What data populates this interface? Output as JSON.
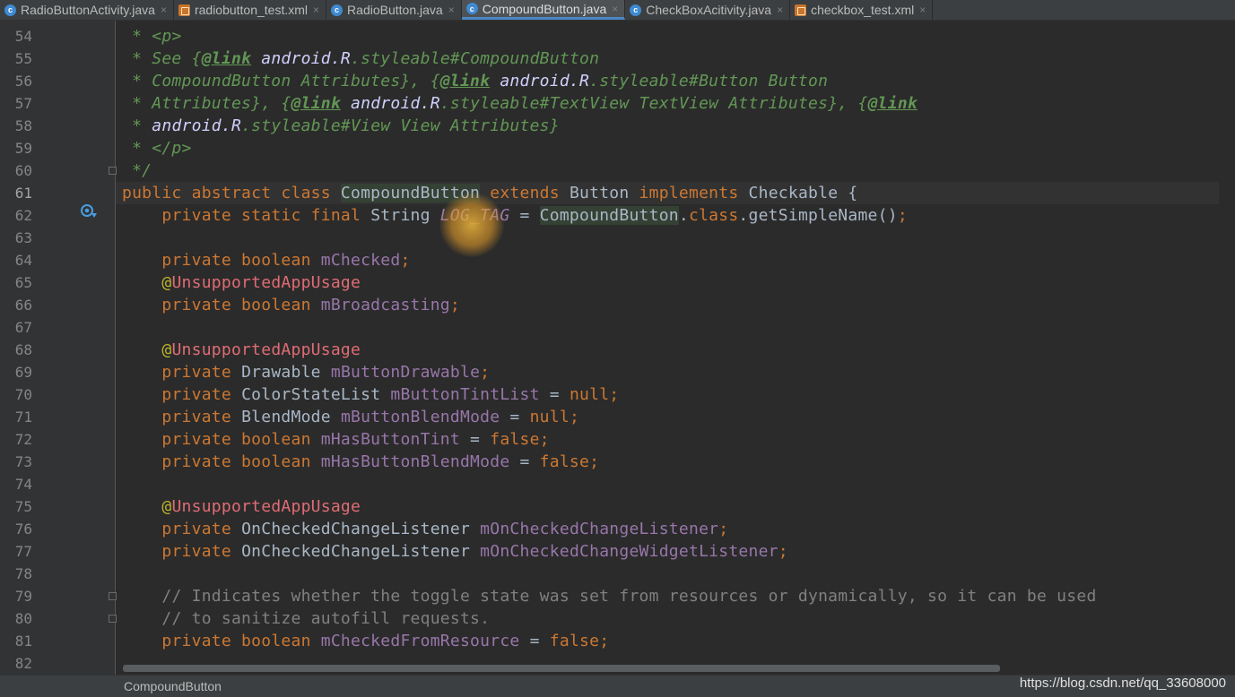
{
  "tabs": [
    {
      "name": "RadioButtonActivity.java",
      "type": "java",
      "active": false
    },
    {
      "name": "radiobutton_test.xml",
      "type": "xml",
      "active": false
    },
    {
      "name": "RadioButton.java",
      "type": "java",
      "active": false
    },
    {
      "name": "CompoundButton.java",
      "type": "java",
      "active": true
    },
    {
      "name": "CheckBoxAcitivity.java",
      "type": "java",
      "active": false
    },
    {
      "name": "checkbox_test.xml",
      "type": "xml",
      "active": false
    }
  ],
  "tab_close_glyph": "×",
  "editor": {
    "current_line": 61,
    "lines": [
      {
        "n": 54,
        "tokens": [
          [
            "doc",
            " * "
          ],
          [
            "doc",
            "<p>"
          ]
        ]
      },
      {
        "n": 55,
        "tokens": [
          [
            "doc",
            " * See {"
          ],
          [
            "doctag",
            "@link"
          ],
          [
            "doc",
            " "
          ],
          [
            "docb",
            "android.R"
          ],
          [
            "doc",
            ".styleable#CompoundButton"
          ]
        ]
      },
      {
        "n": 56,
        "tokens": [
          [
            "doc",
            " * CompoundButton Attributes}, {"
          ],
          [
            "doctag",
            "@link"
          ],
          [
            "doc",
            " "
          ],
          [
            "docb",
            "android.R"
          ],
          [
            "doc",
            ".styleable#Button Button"
          ]
        ]
      },
      {
        "n": 57,
        "tokens": [
          [
            "doc",
            " * Attributes}, {"
          ],
          [
            "doctag",
            "@link"
          ],
          [
            "doc",
            " "
          ],
          [
            "docb",
            "android.R"
          ],
          [
            "doc",
            ".styleable#TextView TextView Attributes}, {"
          ],
          [
            "doctag",
            "@link"
          ]
        ]
      },
      {
        "n": 58,
        "tokens": [
          [
            "doc",
            " * "
          ],
          [
            "docb",
            "android.R"
          ],
          [
            "doc",
            ".styleable#View View Attributes}"
          ]
        ]
      },
      {
        "n": 59,
        "tokens": [
          [
            "doc",
            " * </p>"
          ]
        ]
      },
      {
        "n": 60,
        "tokens": [
          [
            "doc",
            " */"
          ]
        ]
      },
      {
        "n": 61,
        "tokens": [
          [
            "kw",
            "public abstract class "
          ],
          [
            "hl",
            "CompoundButton"
          ],
          [
            "pl",
            " "
          ],
          [
            "kw",
            "extends "
          ],
          [
            "pl",
            "Button "
          ],
          [
            "kw",
            "implements "
          ],
          [
            "pl",
            "Checkable {"
          ]
        ]
      },
      {
        "n": 62,
        "tokens": [
          [
            "pl",
            "    "
          ],
          [
            "kw",
            "private static final "
          ],
          [
            "pl",
            "String "
          ],
          [
            "sfield",
            "LOG_TAG"
          ],
          [
            "pl",
            " = "
          ],
          [
            "hl",
            "CompoundButton"
          ],
          [
            "pl",
            "."
          ],
          [
            "kw",
            "class"
          ],
          [
            "pl",
            ".getSimpleName()"
          ],
          [
            "kw",
            ";"
          ]
        ]
      },
      {
        "n": 63,
        "tokens": []
      },
      {
        "n": 64,
        "tokens": [
          [
            "pl",
            "    "
          ],
          [
            "kw",
            "private boolean "
          ],
          [
            "field",
            "mChecked"
          ],
          [
            "kw",
            ";"
          ]
        ]
      },
      {
        "n": 65,
        "tokens": [
          [
            "pl",
            "    "
          ],
          [
            "anno",
            "@"
          ],
          [
            "annoerr",
            "UnsupportedAppUsage"
          ]
        ]
      },
      {
        "n": 66,
        "tokens": [
          [
            "pl",
            "    "
          ],
          [
            "kw",
            "private boolean "
          ],
          [
            "field",
            "mBroadcasting"
          ],
          [
            "kw",
            ";"
          ]
        ]
      },
      {
        "n": 67,
        "tokens": []
      },
      {
        "n": 68,
        "tokens": [
          [
            "pl",
            "    "
          ],
          [
            "anno",
            "@"
          ],
          [
            "annoerr",
            "UnsupportedAppUsage"
          ]
        ]
      },
      {
        "n": 69,
        "tokens": [
          [
            "pl",
            "    "
          ],
          [
            "kw",
            "private "
          ],
          [
            "pl",
            "Drawable "
          ],
          [
            "field",
            "mButtonDrawable"
          ],
          [
            "kw",
            ";"
          ]
        ]
      },
      {
        "n": 70,
        "tokens": [
          [
            "pl",
            "    "
          ],
          [
            "kw",
            "private "
          ],
          [
            "pl",
            "ColorStateList "
          ],
          [
            "field",
            "mButtonTintList"
          ],
          [
            "pl",
            " = "
          ],
          [
            "kw",
            "null;"
          ]
        ]
      },
      {
        "n": 71,
        "tokens": [
          [
            "pl",
            "    "
          ],
          [
            "kw",
            "private "
          ],
          [
            "pl",
            "BlendMode "
          ],
          [
            "field",
            "mButtonBlendMode"
          ],
          [
            "pl",
            " = "
          ],
          [
            "kw",
            "null;"
          ]
        ]
      },
      {
        "n": 72,
        "tokens": [
          [
            "pl",
            "    "
          ],
          [
            "kw",
            "private boolean "
          ],
          [
            "field",
            "mHasButtonTint"
          ],
          [
            "pl",
            " = "
          ],
          [
            "kw",
            "false;"
          ]
        ]
      },
      {
        "n": 73,
        "tokens": [
          [
            "pl",
            "    "
          ],
          [
            "kw",
            "private boolean "
          ],
          [
            "field",
            "mHasButtonBlendMode"
          ],
          [
            "pl",
            " = "
          ],
          [
            "kw",
            "false;"
          ]
        ]
      },
      {
        "n": 74,
        "tokens": []
      },
      {
        "n": 75,
        "tokens": [
          [
            "pl",
            "    "
          ],
          [
            "anno",
            "@"
          ],
          [
            "annoerr",
            "UnsupportedAppUsage"
          ]
        ]
      },
      {
        "n": 76,
        "tokens": [
          [
            "pl",
            "    "
          ],
          [
            "kw",
            "private "
          ],
          [
            "pl",
            "OnCheckedChangeListener "
          ],
          [
            "field",
            "mOnCheckedChangeListener"
          ],
          [
            "kw",
            ";"
          ]
        ]
      },
      {
        "n": 77,
        "tokens": [
          [
            "pl",
            "    "
          ],
          [
            "kw",
            "private "
          ],
          [
            "pl",
            "OnCheckedChangeListener "
          ],
          [
            "field",
            "mOnCheckedChangeWidgetListener"
          ],
          [
            "kw",
            ";"
          ]
        ]
      },
      {
        "n": 78,
        "tokens": []
      },
      {
        "n": 79,
        "tokens": [
          [
            "pl",
            "    "
          ],
          [
            "cmt",
            "// Indicates whether the toggle state was set from resources or dynamically, so it can be used"
          ]
        ]
      },
      {
        "n": 80,
        "tokens": [
          [
            "pl",
            "    "
          ],
          [
            "cmt",
            "// to sanitize autofill requests."
          ]
        ]
      },
      {
        "n": 81,
        "tokens": [
          [
            "pl",
            "    "
          ],
          [
            "kw",
            "private boolean "
          ],
          [
            "field",
            "mCheckedFromResource"
          ],
          [
            "pl",
            " = "
          ],
          [
            "kw",
            "false;"
          ]
        ]
      },
      {
        "n": 82,
        "tokens": []
      }
    ]
  },
  "fold_marker_lines": [
    60,
    79,
    80
  ],
  "status": {
    "breadcrumb": "CompoundButton",
    "watermark": "https://blog.csdn.net/qq_33608000"
  },
  "colors": {
    "background": "#2b2b2b",
    "keyword": "#cc7832",
    "javadoc": "#629755",
    "field": "#9876aa",
    "annotation": "#bbb529",
    "unresolved": "#e06c75",
    "comment": "#808080",
    "plain": "#a9b7c6",
    "active_tab_underline": "#4a88c7"
  },
  "icons": {
    "java_file": "circle-c-icon",
    "xml_file": "xml-file-icon",
    "override_marker": "overriding-method-icon",
    "fold": "fold-marker-icon"
  }
}
